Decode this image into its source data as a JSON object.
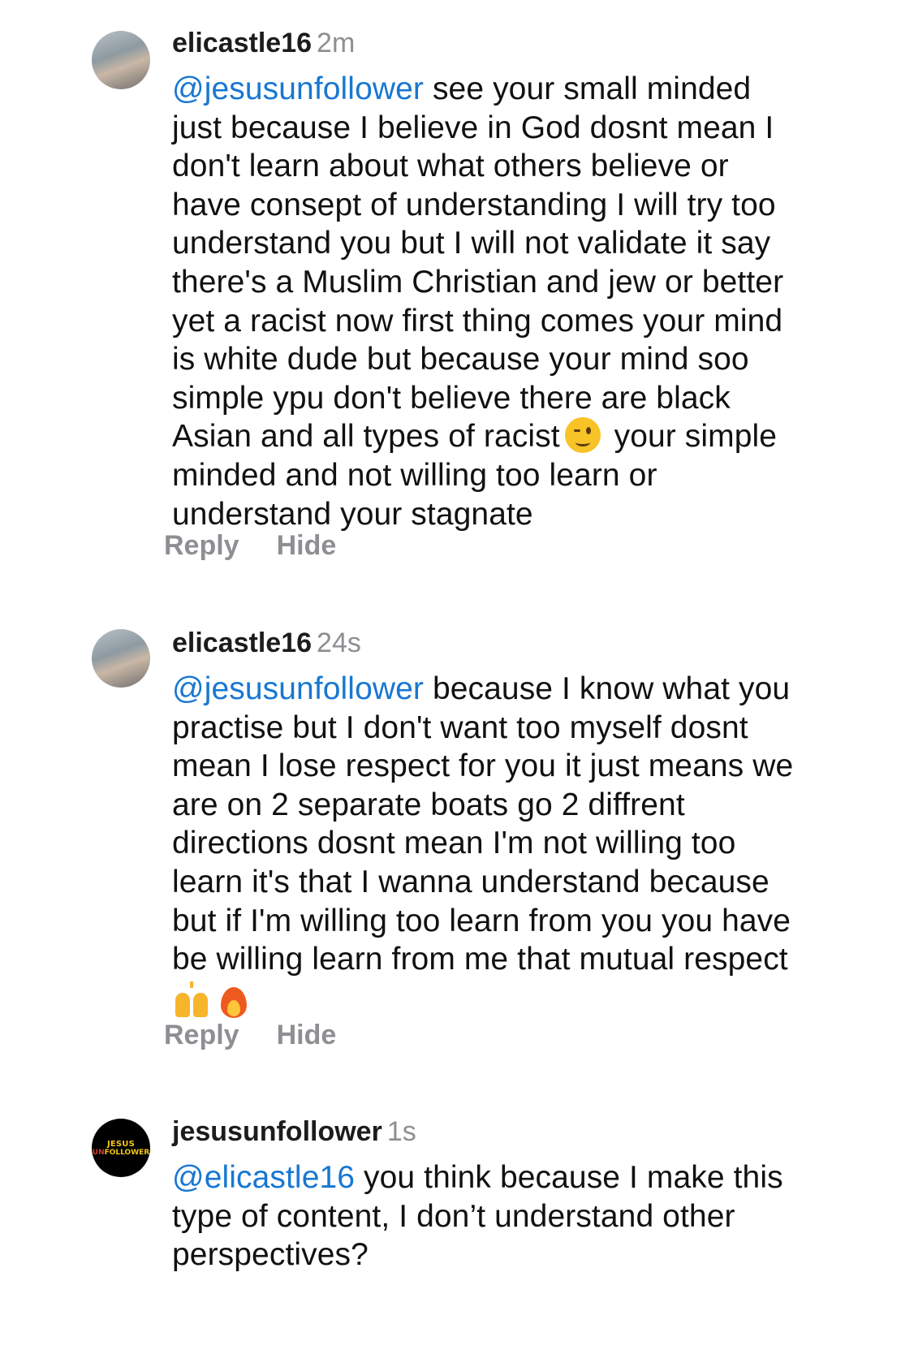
{
  "comments": [
    {
      "username": "elicastle16",
      "time": "2m",
      "mention": "@jesusunfollower",
      "text_part1": " see your small minded\njust because I believe in God dosnt mean I\ndon't learn about what others believe or\nhave consept of understanding I will try too\nunderstand you but I will not validate it say\nthere's a Muslim Christian and jew or better\nyet a racist now first thing comes your mind\nis white dude but because your mind soo\nsimple ypu don't believe there are black\nAsian and all types of racist",
      "emoji": "winking-face",
      "text_part2": " your simple\nminded and not willing too learn or\nunderstand your stagnate",
      "avatar": "profile-photo",
      "actions": {
        "reply": "Reply",
        "hide": "Hide"
      }
    },
    {
      "username": "elicastle16",
      "time": "24s",
      "mention": "@jesusunfollower",
      "text_part1": " because I know what you\npractise but I don't want too myself dosnt\nmean I lose respect for you it just means we\nare on 2 separate boats go 2 diffrent\ndirections dosnt mean I'm not willing too\nlearn it's that I wanna understand because\nbut if I'm willing too learn from you you have\nbe willing learn from me that mutual respect",
      "emojis": [
        "raising-hands",
        "fire"
      ],
      "avatar": "profile-photo",
      "actions": {
        "reply": "Reply",
        "hide": "Hide"
      }
    },
    {
      "username": "jesusunfollower",
      "time": "1s",
      "mention": "@elicastle16",
      "text_part1": " you think because I make this\ntype of content, I don’t understand other\nperspectives?",
      "avatar": "brand-logo",
      "avatar_text": {
        "line1": "JESUS",
        "line2_a": "UN",
        "line2_b": "FOLLOWER"
      }
    }
  ],
  "colors": {
    "mention": "#1877d2",
    "muted": "#8e8e93",
    "text": "#111111",
    "brand_yellow": "#f3c613",
    "brand_red": "#d33a2c"
  }
}
